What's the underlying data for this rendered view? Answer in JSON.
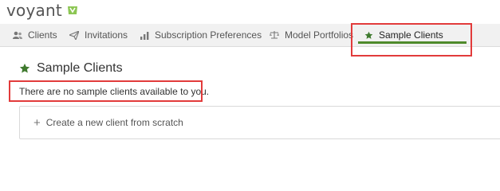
{
  "brand": {
    "name": "voyant"
  },
  "nav": {
    "items": [
      {
        "label": "Clients",
        "icon": "users-icon"
      },
      {
        "label": "Invitations",
        "icon": "paper-plane-icon"
      },
      {
        "label": "Subscription Preferences",
        "icon": "bar-chart-icon"
      },
      {
        "label": "Model Portfolios",
        "icon": "scale-icon"
      },
      {
        "label": "Sample Clients",
        "icon": "star-icon",
        "active": true
      }
    ]
  },
  "page": {
    "title": "Sample Clients",
    "message": "There are no sample clients available to you.",
    "create_label": "Create a new client from scratch"
  },
  "colors": {
    "accent": "#4f8a2b",
    "highlight": "#e23b3b",
    "star": "#3f7a2e"
  }
}
